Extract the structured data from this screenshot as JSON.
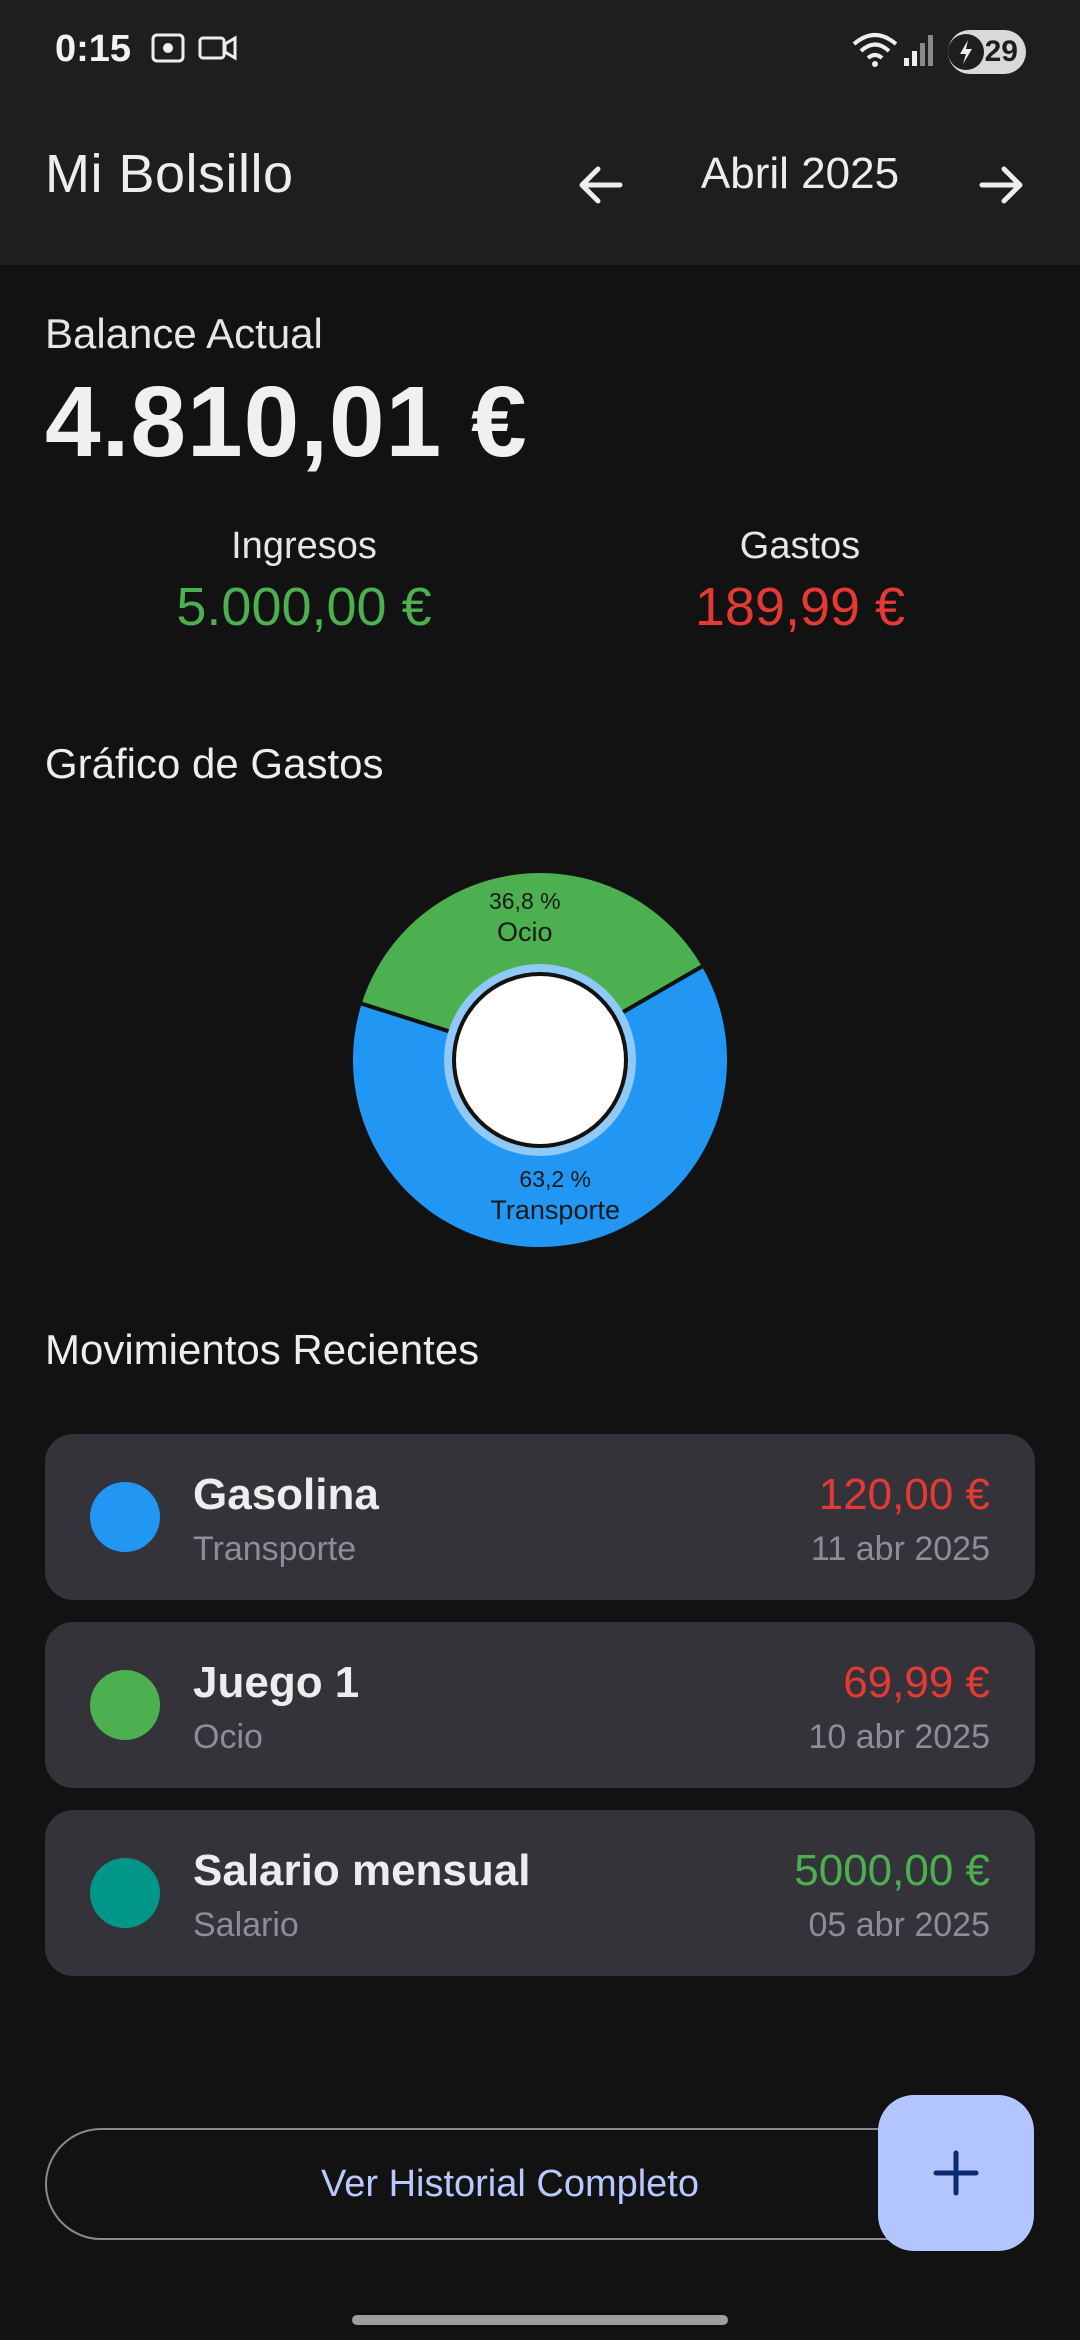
{
  "status_bar": {
    "time": "0:15",
    "battery": "29"
  },
  "app_bar": {
    "title": "Mi Bolsillo",
    "month": "Abril 2025"
  },
  "balance": {
    "label": "Balance Actual",
    "value": "4.810,01 €"
  },
  "summary": {
    "income_label": "Ingresos",
    "income_value": "5.000,00 €",
    "expense_label": "Gastos",
    "expense_value": "189,99 €"
  },
  "chart_section": {
    "title": "Gráfico de Gastos"
  },
  "chart_data": {
    "type": "pie",
    "title": "",
    "slices": [
      {
        "label": "Transporte",
        "value": 63.2,
        "percent_label": "63,2 %",
        "color": "#2196F3"
      },
      {
        "label": "Ocio",
        "value": 36.8,
        "percent_label": "36,8 %",
        "color": "#4CAF50"
      }
    ]
  },
  "recent": {
    "title": "Movimientos Recientes",
    "items": [
      {
        "title": "Gasolina",
        "category": "Transporte",
        "amount": "120,00 €",
        "date": "11 abr 2025",
        "color": "#2196F3",
        "amount_color": "#E53935"
      },
      {
        "title": "Juego 1",
        "category": "Ocio",
        "amount": "69,99 €",
        "date": "10 abr 2025",
        "color": "#4CAF50",
        "amount_color": "#E53935"
      },
      {
        "title": "Salario mensual",
        "category": "Salario",
        "amount": "5000,00 €",
        "date": "05 abr 2025",
        "color": "#009688",
        "amount_color": "#4CAF50"
      }
    ]
  },
  "footer": {
    "history_button": "Ver Historial Completo",
    "fab_icon": "plus-icon"
  },
  "colors": {
    "background": "#121212",
    "surface": "#1E1E1E",
    "card": "#34333A",
    "income": "#4CAF50",
    "expense": "#E53935",
    "accent": "#B3C5FF"
  }
}
